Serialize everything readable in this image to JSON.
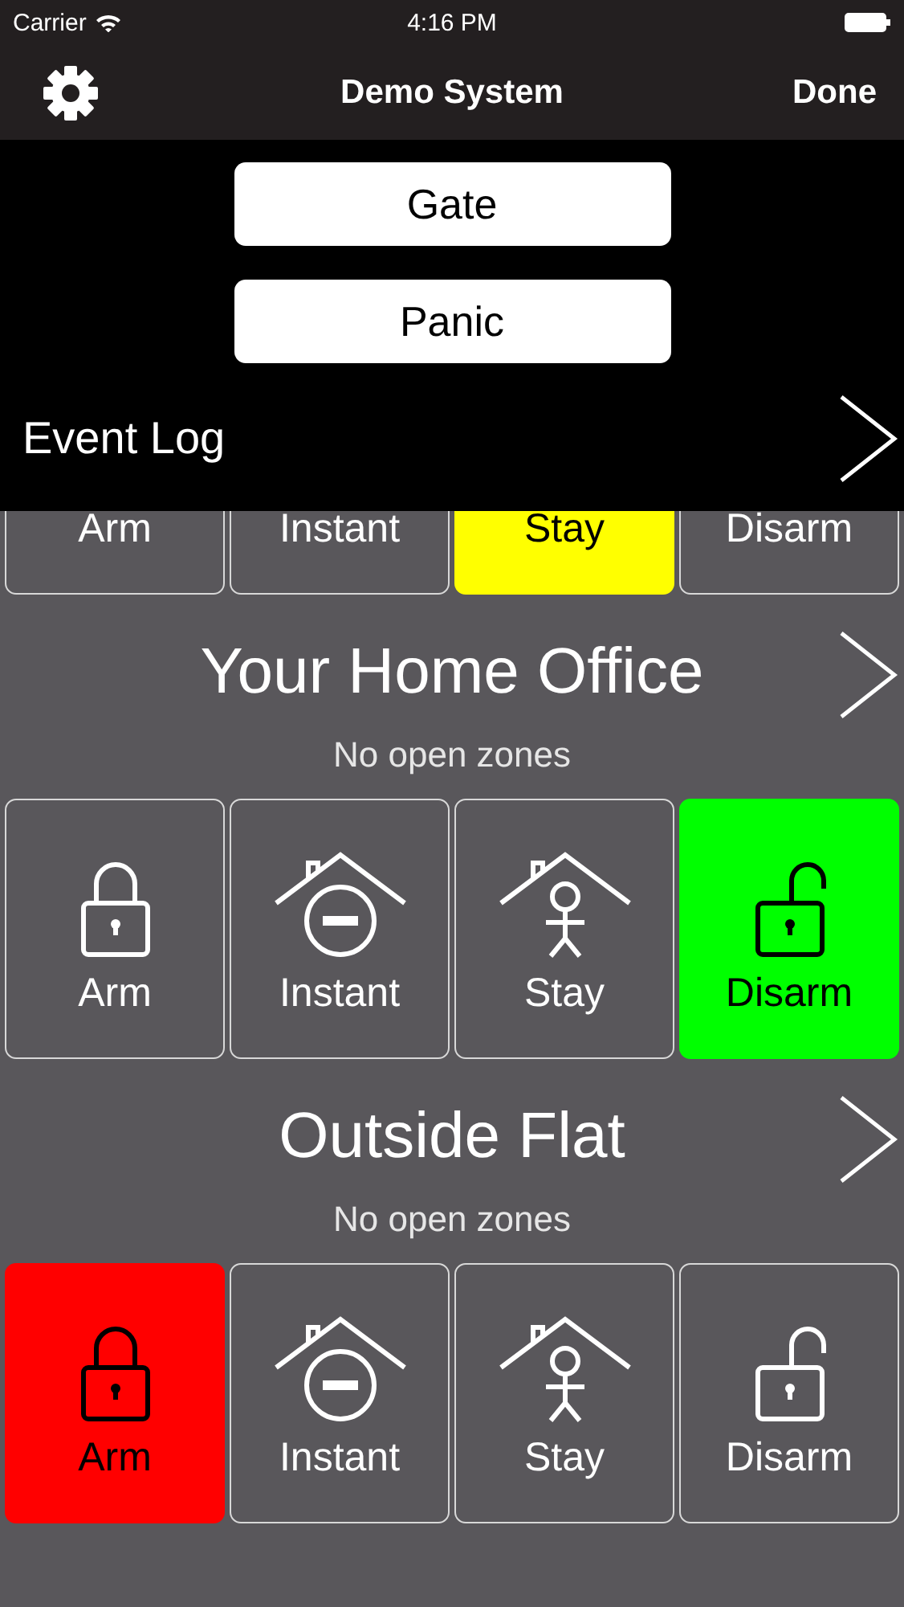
{
  "status_bar": {
    "carrier": "Carrier",
    "time": "4:16 PM"
  },
  "nav_bar": {
    "title": "Demo System",
    "done": "Done"
  },
  "quick_panel": {
    "buttons": [
      "Gate",
      "Panic"
    ],
    "event_log": "Event Log"
  },
  "partial_partition": {
    "buttons": [
      {
        "label": "Arm",
        "selected": false
      },
      {
        "label": "Instant",
        "selected": false
      },
      {
        "kind": "stay",
        "label": "Stay",
        "selected": true
      },
      {
        "label": "Disarm",
        "selected": false
      }
    ]
  },
  "partitions": [
    {
      "name": "Your Home Office",
      "status": "No open zones",
      "buttons": [
        {
          "kind": "arm",
          "label": "Arm",
          "selected": false
        },
        {
          "kind": "instant",
          "label": "Instant",
          "selected": false
        },
        {
          "kind": "stay",
          "label": "Stay",
          "selected": false
        },
        {
          "kind": "disarm",
          "label": "Disarm",
          "selected": true
        }
      ]
    },
    {
      "name": "Outside Flat",
      "status": "No open zones",
      "buttons": [
        {
          "kind": "arm",
          "label": "Arm",
          "selected": true
        },
        {
          "kind": "instant",
          "label": "Instant",
          "selected": false
        },
        {
          "kind": "stay",
          "label": "Stay",
          "selected": false
        },
        {
          "kind": "disarm",
          "label": "Disarm",
          "selected": false
        }
      ]
    }
  ]
}
